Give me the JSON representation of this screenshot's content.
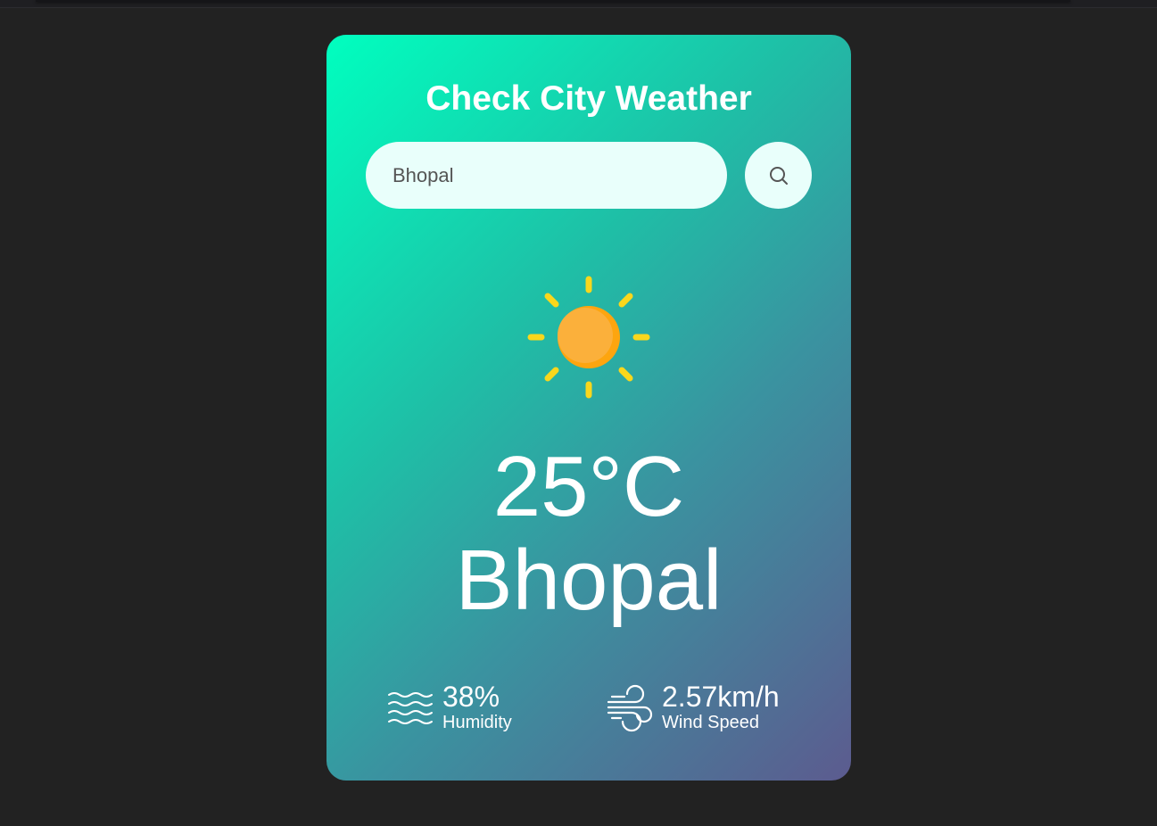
{
  "app": {
    "title": "Check City Weather"
  },
  "search": {
    "value": "Bhopal",
    "placeholder": "",
    "button_icon": "search-icon"
  },
  "weather": {
    "icon": "sun-icon",
    "temperature": "25°C",
    "city": "Bhopal",
    "humidity": {
      "icon": "humidity-waves-icon",
      "value": "38%",
      "label": "Humidity"
    },
    "wind": {
      "icon": "wind-icon",
      "value": "2.57km/h",
      "label": "Wind Speed"
    }
  },
  "colors": {
    "page_background": "#222222",
    "card_gradient_start": "#00ffbf",
    "card_gradient_end": "#5c5b8f",
    "input_background": "#e9fffb",
    "sun_rays": "#f9d71c",
    "sun_core": "#fbb03b"
  }
}
